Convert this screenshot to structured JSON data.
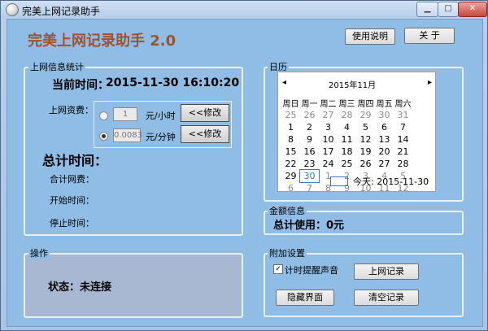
{
  "window": {
    "title": "完美上网记录助手"
  },
  "app": {
    "heading": "完美上网记录助手 2.0"
  },
  "toolbar": {
    "help_label": "使用说明",
    "about_label": "关 于"
  },
  "stats": {
    "legend": "上网信息统计",
    "current_time_label": "当前时间：",
    "current_time_value": "2015-11-30 16:10:20",
    "fee_label": "上网资费：",
    "hourly": {
      "value": "1",
      "unit": "元/小时",
      "modify_label": "<<修改",
      "selected": false
    },
    "minute": {
      "value": "0.0083",
      "unit": "元/分钟",
      "modify_label": "<<修改",
      "selected": true
    },
    "total_time_label": "总计时间：",
    "total_fee_label": "合计网费：",
    "start_time_label": "开始时间：",
    "stop_time_label": "停止时间："
  },
  "calendar": {
    "legend": "日历",
    "month_title": "2015年11月",
    "weekdays": [
      "周日",
      "周一",
      "周二",
      "周三",
      "周四",
      "周五",
      "周六"
    ],
    "rows": [
      [
        "25",
        "26",
        "27",
        "28",
        "29",
        "30",
        "31"
      ],
      [
        "1",
        "2",
        "3",
        "4",
        "5",
        "6",
        "7"
      ],
      [
        "8",
        "9",
        "10",
        "11",
        "12",
        "13",
        "14"
      ],
      [
        "15",
        "16",
        "17",
        "18",
        "19",
        "20",
        "21"
      ],
      [
        "22",
        "23",
        "24",
        "25",
        "26",
        "27",
        "28"
      ],
      [
        "29",
        "30",
        "1",
        "2",
        "3",
        "4",
        "5"
      ],
      [
        "6",
        "7",
        "8",
        "9",
        "10",
        "11",
        "12"
      ]
    ],
    "today_label": "今天: 2015-11-30",
    "selected_day": "30"
  },
  "amount": {
    "legend": "金额信息",
    "total_label": "总计使用：0元"
  },
  "operation": {
    "legend": "操作",
    "status": "状态：未连接"
  },
  "extra": {
    "legend": "附加设置",
    "sound_label": "计时提醒声音",
    "sound_checked": true,
    "records_label": "上网记录",
    "hide_label": "隐藏界面",
    "clear_label": "清空记录"
  }
}
